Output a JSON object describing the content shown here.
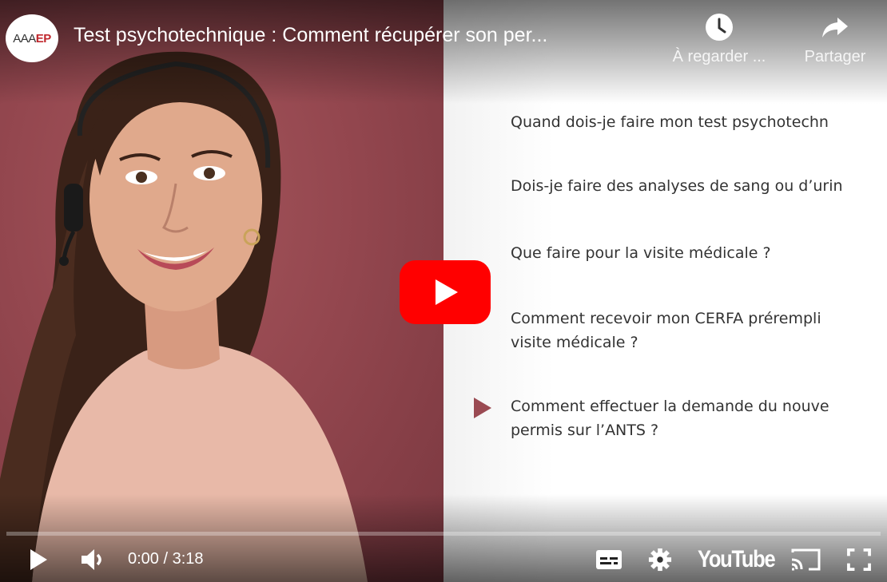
{
  "channel": {
    "logo_text_a": "AAA",
    "logo_text_b": "EP"
  },
  "video": {
    "title": "Test psychotechnique : Comment récupérer son per..."
  },
  "actions": {
    "watch_later": {
      "label": "À regarder ...",
      "icon": "clock-icon"
    },
    "share": {
      "label": "Partager",
      "icon": "share-arrow-icon"
    }
  },
  "slide": {
    "items": [
      {
        "lines": [
          "Quand dois-je faire mon test psychotechn"
        ]
      },
      {
        "lines": [
          "Dois-je faire des analyses de sang ou d’urin"
        ]
      },
      {
        "lines": [
          "Que faire pour la visite médicale ?"
        ]
      },
      {
        "lines": [
          "Comment recevoir mon CERFA prérempli",
          "visite médicale ?"
        ]
      },
      {
        "lines": [
          "Comment effectuer la demande du nouve",
          "permis sur l’ANTS ?"
        ],
        "active": true
      }
    ]
  },
  "controls": {
    "time_display": "0:00 / 3:18",
    "brand": "YouTube",
    "progress": 0.0
  },
  "colors": {
    "accent_red": "#ff0000",
    "slide_bullet": "#9a4a52",
    "background_rose": "#94474f"
  }
}
